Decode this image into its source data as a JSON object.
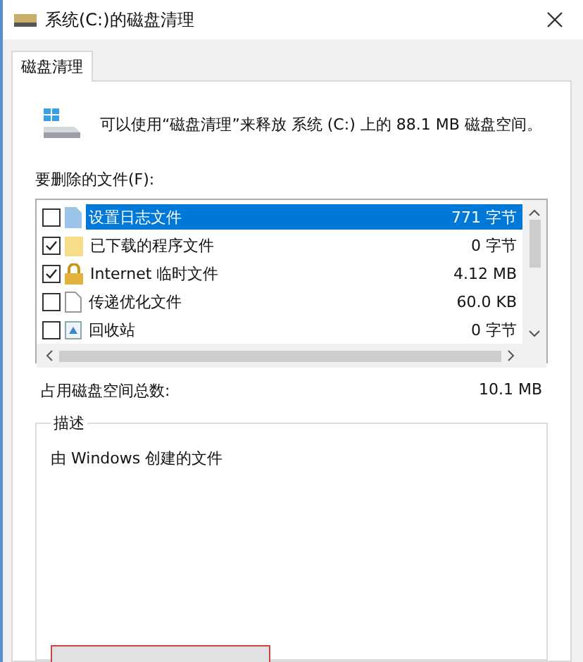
{
  "window": {
    "title": "系统(C:)的磁盘清理"
  },
  "tabs": [
    {
      "label": "磁盘清理",
      "selected": true
    }
  ],
  "summary": "可以使用“磁盘清理”来释放 系统 (C:) 上的 88.1 MB 磁盘空间。",
  "files_label": "要删除的文件(F):",
  "files": [
    {
      "name": "设置日志文件",
      "size": "771 字节",
      "checked": false,
      "selected": true,
      "kind": "document"
    },
    {
      "name": "已下载的程序文件",
      "size": "0 字节",
      "checked": true,
      "selected": false,
      "kind": "folder"
    },
    {
      "name": "Internet 临时文件",
      "size": "4.12 MB",
      "checked": true,
      "selected": false,
      "kind": "lock"
    },
    {
      "name": "传递优化文件",
      "size": "60.0 KB",
      "checked": false,
      "selected": false,
      "kind": "blank"
    },
    {
      "name": "回收站",
      "size": "0 字节",
      "checked": false,
      "selected": false,
      "kind": "recycle"
    }
  ],
  "total": {
    "label": "占用磁盘空间总数:",
    "value": "10.1 MB"
  },
  "description": {
    "legend": "描述",
    "text": "由 Windows 创建的文件"
  }
}
